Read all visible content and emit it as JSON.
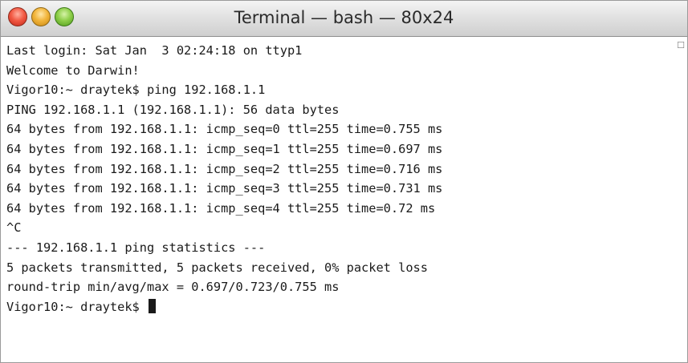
{
  "window": {
    "title": "Terminal — bash — 80x24"
  },
  "icons": {
    "close": "close-button",
    "minimize": "minimize-button",
    "zoom": "zoom-button"
  },
  "colors": {
    "close": "#f25a44",
    "minimize": "#f2b53c",
    "zoom": "#8fcf4a",
    "text": "#1a1a1a",
    "background": "#ffffff"
  },
  "terminal": {
    "lines": [
      "Last login: Sat Jan  3 02:24:18 on ttyp1",
      "Welcome to Darwin!",
      "Vigor10:~ draytek$ ping 192.168.1.1",
      "PING 192.168.1.1 (192.168.1.1): 56 data bytes",
      "64 bytes from 192.168.1.1: icmp_seq=0 ttl=255 time=0.755 ms",
      "64 bytes from 192.168.1.1: icmp_seq=1 ttl=255 time=0.697 ms",
      "64 bytes from 192.168.1.1: icmp_seq=2 ttl=255 time=0.716 ms",
      "64 bytes from 192.168.1.1: icmp_seq=3 ttl=255 time=0.731 ms",
      "64 bytes from 192.168.1.1: icmp_seq=4 ttl=255 time=0.72 ms",
      "^C",
      "--- 192.168.1.1 ping statistics ---",
      "5 packets transmitted, 5 packets received, 0% packet loss",
      "round-trip min/avg/max = 0.697/0.723/0.755 ms"
    ],
    "prompt": "Vigor10:~ draytek$ "
  }
}
